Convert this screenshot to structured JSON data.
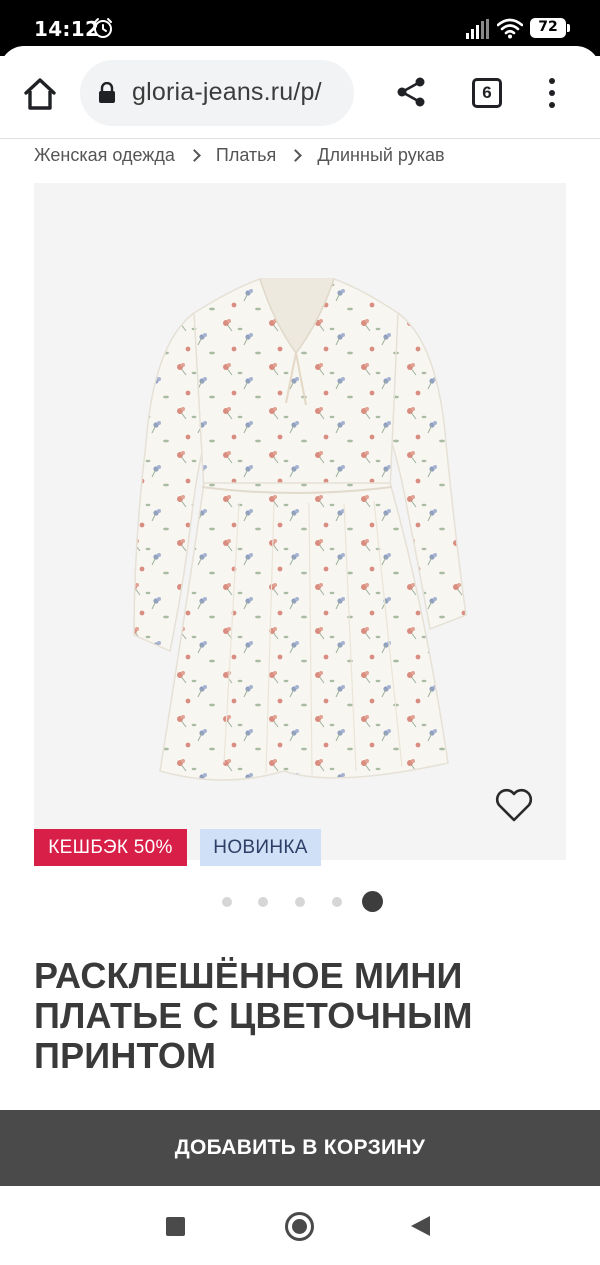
{
  "status_bar": {
    "time": "14:12",
    "battery": "72",
    "icons": [
      "alarm-icon",
      "signal-icon",
      "wifi-icon",
      "battery-icon"
    ]
  },
  "browser": {
    "url": "gloria-jeans.ru/p/",
    "tab_count": "6",
    "icons": [
      "home-icon",
      "lock-icon",
      "share-icon",
      "menu-icon"
    ]
  },
  "breadcrumb": {
    "items": [
      "Женская одежда",
      "Платья",
      "Длинный рукав"
    ]
  },
  "product": {
    "badges": {
      "cashback": "КЕШБЭК 50%",
      "new": "НОВИНКА"
    },
    "carousel": {
      "count": 5,
      "active_index": 4
    },
    "title": "РАСКЛЕШЁННОЕ МИНИ ПЛАТЬЕ С ЦВЕТОЧНЫМ ПРИНТОМ",
    "add_to_cart": "ДОБАВИТЬ В КОРЗИНУ"
  },
  "colors": {
    "accent_cashback": "#d81f48",
    "badge_new_bg": "#cfe0f7",
    "button_bg": "#4a4a4a"
  },
  "nav_bar": {
    "icons": [
      "recents-icon",
      "home-circle-icon",
      "back-icon"
    ]
  }
}
